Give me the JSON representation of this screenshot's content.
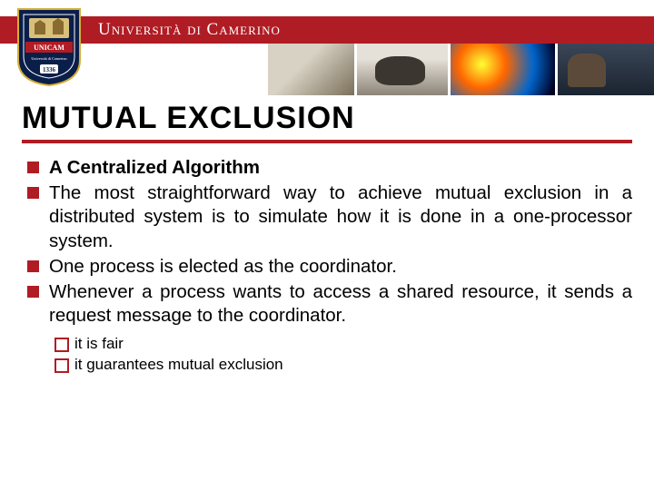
{
  "header": {
    "university_name": "Università di Camerino",
    "shield_label_top": "UNICAM",
    "shield_label_mid": "Università di Camerino",
    "shield_year": "1336"
  },
  "slide": {
    "title": "MUTUAL EXCLUSION",
    "bullets": [
      {
        "text": "A Centralized Algorithm",
        "bold": true
      },
      {
        "text": "The most straightforward way to achieve mutual exclusion in a distributed system is to simulate how it is done in a one-processor system.",
        "bold": false
      },
      {
        "text": "One process is elected as the coordinator.",
        "bold": false
      },
      {
        "text": "Whenever a process wants to access a shared resource, it sends a request message to the coordinator.",
        "bold": false
      }
    ],
    "sub_bullets": [
      "it is fair",
      "it guarantees mutual exclusion"
    ]
  }
}
